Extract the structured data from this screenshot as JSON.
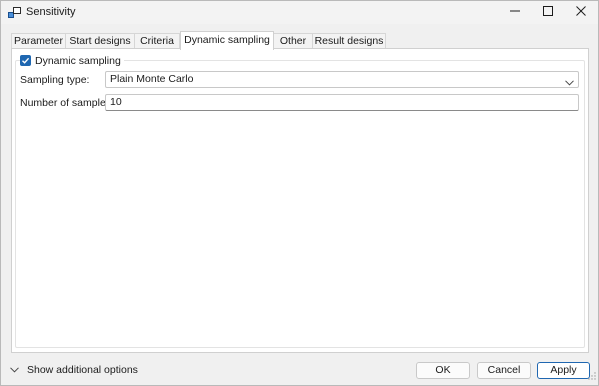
{
  "window": {
    "title": "Sensitivity"
  },
  "tabs": [
    {
      "label": "Parameter"
    },
    {
      "label": "Start designs"
    },
    {
      "label": "Criteria"
    },
    {
      "label": "Dynamic sampling",
      "active": true
    },
    {
      "label": "Other"
    },
    {
      "label": "Result designs"
    }
  ],
  "dynamic_sampling": {
    "enabled_label": "Dynamic sampling",
    "enabled": true,
    "sampling_type_label": "Sampling type:",
    "sampling_type_value": "Plain Monte Carlo",
    "samples_label": "Number of samples:",
    "samples_value": "10"
  },
  "footer": {
    "more_options_label": "Show additional options",
    "ok_label": "OK",
    "cancel_label": "Cancel",
    "apply_label": "Apply"
  },
  "colors": {
    "accent": "#1f67b1"
  },
  "icons": {
    "app": "app-icon",
    "minimize": "minimize-icon",
    "maximize": "maximize-icon",
    "close": "close-icon",
    "dropdown": "chevron-down-icon",
    "expand": "chevron-down-icon",
    "checkbox": "check-icon"
  }
}
